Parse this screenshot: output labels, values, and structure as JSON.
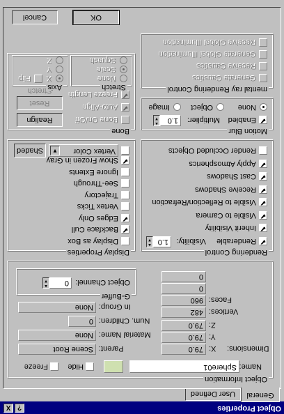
{
  "window": {
    "title": "Object Properties",
    "help_btn": "?",
    "close_btn": "X"
  },
  "tabs": [
    "General",
    "User Defined"
  ],
  "object_info": {
    "legend": "Object Information",
    "name_label": "Name:",
    "name_value": "Sphere01",
    "hide_label": "Hide",
    "freeze_label": "Freeze",
    "dimensions_label": "Dimensions:",
    "x_label": "X:",
    "x_value": "79.0",
    "y_label": "Y:",
    "y_value": "79.0",
    "z_label": "Z:",
    "z_value": "79.0",
    "vertices_label": "Vertices:",
    "vertices_value": "482",
    "faces_label": "Faces:",
    "faces_value": "960",
    "extra1_value": "0",
    "extra2_value": "0",
    "parent_label": "Parent:",
    "parent_value": "Scene Root",
    "material_label": "Material Name:",
    "material_value": "None",
    "children_label": "Num. Children:",
    "children_value": "0",
    "group_label": "In Group:",
    "group_value": "None",
    "color_hex": "#cfe0b0"
  },
  "gbuffer": {
    "legend": "G-Buffer",
    "channel_label": "Object Channel:",
    "channel_value": "0"
  },
  "rendering_control": {
    "legend": "Rendering Control",
    "visibility_label": "Visibility:",
    "visibility_value": "1.0",
    "items": [
      {
        "label": "Renderable",
        "checked": true
      },
      {
        "label": "Inherit Visibility",
        "checked": true
      },
      {
        "label": "Visible to Camera",
        "checked": true
      },
      {
        "label": "Visible to Reflection/Refraction",
        "checked": true
      },
      {
        "label": "Receive Shadows",
        "checked": true
      },
      {
        "label": "Cast Shadows",
        "checked": true
      },
      {
        "label": "Apply Atmospherics",
        "checked": true
      },
      {
        "label": "Render Occluded Objects",
        "checked": false
      }
    ]
  },
  "display_props": {
    "legend": "Display Properties",
    "items": [
      {
        "label": "Display as Box",
        "checked": false
      },
      {
        "label": "Backface Cull",
        "checked": true
      },
      {
        "label": "Edges Only",
        "checked": true
      },
      {
        "label": "Vertex Ticks",
        "checked": false
      },
      {
        "label": "Trajectory",
        "checked": false
      },
      {
        "label": "See-Through",
        "checked": false
      },
      {
        "label": "Ignore Extents",
        "checked": false
      },
      {
        "label": "Show Frozen in Gray",
        "checked": true
      }
    ],
    "vertex_color_label": "Vertex Color",
    "shaded_label": "Shaded"
  },
  "motion_blur": {
    "legend": "Motion Blur",
    "multiplier_label": "Multiplier:",
    "multiplier_value": "1.0",
    "enabled_label": "Enabled",
    "none_label": "None",
    "object_label": "Object",
    "image_label": "Image"
  },
  "bone": {
    "legend": "Bone",
    "bone_onoff": "Bone On/Off",
    "realign": "Realign",
    "auto_align": "Auto-Align",
    "freeze_length": "Freeze Length",
    "reset_stretch": "Reset Stretch",
    "stretch_legend": "Stretch",
    "none_label": "None",
    "scale_label": "Scale",
    "squash_label": "Squash",
    "axis_legend": "Axis",
    "x_label": "X",
    "y_label": "Y",
    "z_label": "Z",
    "flip_label": "Flip"
  },
  "mental_ray": {
    "legend": "mental ray Rendering Control",
    "items": [
      "Generate Caustics",
      "Receive Caustics",
      "Generate Global Illumination",
      "Receive Global Illumination"
    ]
  },
  "buttons": {
    "ok": "OK",
    "cancel": "Cancel"
  }
}
